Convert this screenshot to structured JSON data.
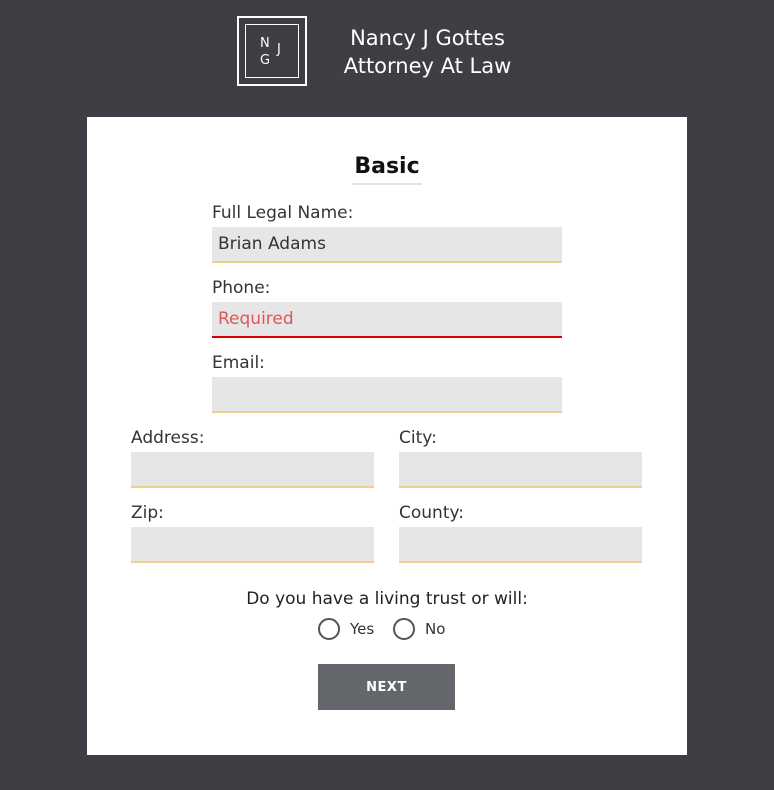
{
  "header": {
    "logo_letters": {
      "n": "N",
      "j": "J",
      "g": "G"
    },
    "firm_name_line1": "Nancy J Gottes",
    "firm_name_line2": "Attorney At Law"
  },
  "form": {
    "section_title": "Basic",
    "full_name": {
      "label": "Full Legal Name:",
      "value": "Brian Adams",
      "placeholder": ""
    },
    "phone": {
      "label": "Phone:",
      "value": "",
      "placeholder": "Required",
      "error": true
    },
    "email": {
      "label": "Email:",
      "value": "",
      "placeholder": ""
    },
    "address": {
      "label": "Address:",
      "value": "",
      "placeholder": ""
    },
    "city": {
      "label": "City:",
      "value": "",
      "placeholder": ""
    },
    "zip": {
      "label": "Zip:",
      "value": "",
      "placeholder": ""
    },
    "county": {
      "label": "County:",
      "value": "",
      "placeholder": ""
    },
    "trust_question": "Do you have a living trust or will:",
    "options": {
      "yes": "Yes",
      "no": "No"
    },
    "next_label": "NEXT"
  },
  "colors": {
    "background": "#3d3f44",
    "card": "#ffffff",
    "field_bg": "#e6e6e6",
    "field_underline": "#f5cc8f",
    "error_underline": "#d40000",
    "error_text": "#e05555",
    "button": "#63666b"
  }
}
